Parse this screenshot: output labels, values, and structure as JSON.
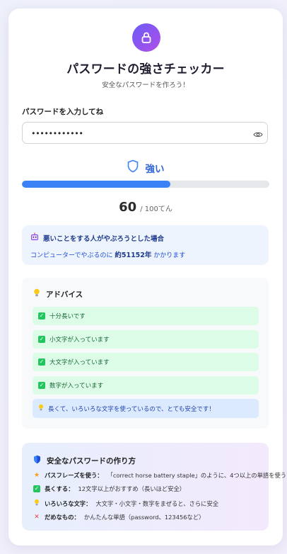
{
  "header": {
    "title": "パスワードの強さチェッカー",
    "subtitle": "安全なパスワードを作ろう！"
  },
  "password_field": {
    "label": "パスワードを入力してね",
    "value": "••••••••••••",
    "visibility_icon": "eye-icon"
  },
  "strength": {
    "label": "強い",
    "icon": "shield-icon",
    "score": "60",
    "max_label": "/ 100てん",
    "progress_fraction": 0.6,
    "color": "#3b82f6"
  },
  "crack_time": {
    "icon": "robot-icon",
    "title": "悪いことをする人がやぶろうとした場合",
    "prefix": "コンピューターでやぶるのに",
    "value": "約51152年",
    "suffix": "かかります"
  },
  "advice": {
    "icon": "lightbulb-icon",
    "title": "アドバイス",
    "items": [
      "十分長いです",
      "小文字が入っています",
      "大文字が入っています",
      "数字が入っています"
    ],
    "summary": "長くて、いろいろな文字を使っているので、とても安全です！"
  },
  "tips": {
    "icon": "shield-icon",
    "title": "安全なパスワードの作り方",
    "items": [
      {
        "icon": "star-icon",
        "label": "パスフレーズを使う：",
        "text": "「correct horse battery staple」のように、4つ以上の単語を使う"
      },
      {
        "icon": "check-icon",
        "label": "長くする：",
        "text": "12文字以上がおすすめ（長いほど安全）"
      },
      {
        "icon": "lightbulb-icon",
        "label": "いろいろな文字：",
        "text": "大文字・小文字・数字をまぜると、さらに安全"
      },
      {
        "icon": "cross-icon",
        "label": "だめなもの：",
        "text": "かんたんな単語（password、123456など）"
      }
    ]
  }
}
